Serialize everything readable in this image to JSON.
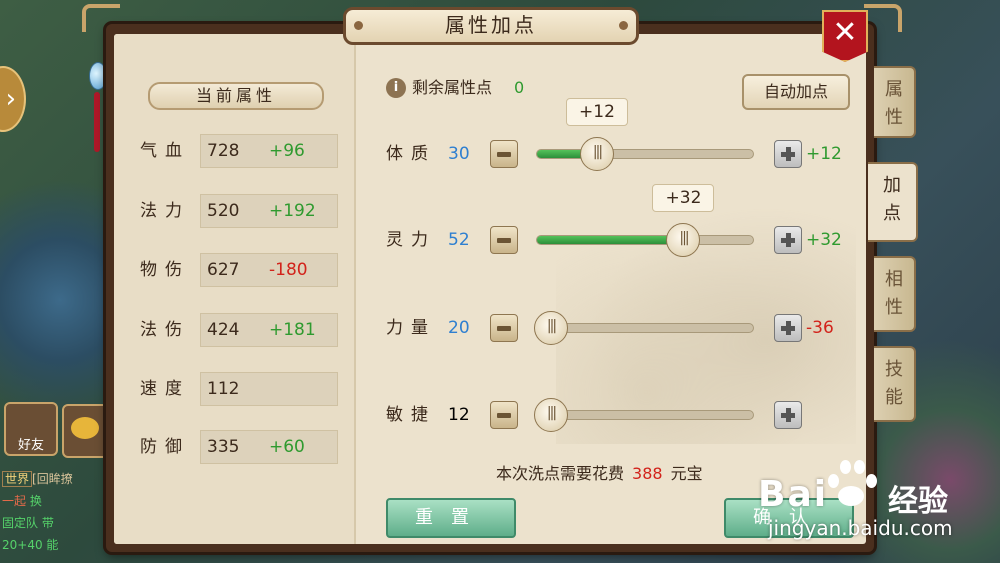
{
  "panel": {
    "title": "属性加点",
    "close_label": "✕"
  },
  "left": {
    "header": "当前属性",
    "stats": [
      {
        "label": "气血",
        "value": "728",
        "bonus": "+96",
        "bonus_kind": "pos"
      },
      {
        "label": "法力",
        "value": "520",
        "bonus": "+192",
        "bonus_kind": "pos"
      },
      {
        "label": "物伤",
        "value": "627",
        "bonus": "-180",
        "bonus_kind": "neg"
      },
      {
        "label": "法伤",
        "value": "424",
        "bonus": "+181",
        "bonus_kind": "pos"
      },
      {
        "label": "速度",
        "value": "112",
        "bonus": "",
        "bonus_kind": ""
      },
      {
        "label": "防御",
        "value": "335",
        "bonus": "+60",
        "bonus_kind": "pos"
      }
    ]
  },
  "right": {
    "info_icon": "i",
    "remaining_label": "剩余属性点",
    "remaining_value": "0",
    "auto_button": "自动加点",
    "attributes": [
      {
        "name": "体质",
        "value": "30",
        "value_color": "blue",
        "fraction": 0.25,
        "bubble": "+12",
        "delta": "+12",
        "delta_kind": "pos"
      },
      {
        "name": "灵力",
        "value": "52",
        "value_color": "blue",
        "fraction": 0.72,
        "bubble": "+32",
        "delta": "+32",
        "delta_kind": "pos"
      },
      {
        "name": "力量",
        "value": "20",
        "value_color": "blue",
        "fraction": 0.0,
        "bubble": "",
        "delta": "-36",
        "delta_kind": "neg"
      },
      {
        "name": "敏捷",
        "value": "12",
        "value_color": "plain",
        "fraction": 0.0,
        "bubble": "",
        "delta": "",
        "delta_kind": ""
      }
    ],
    "cost_prefix": "本次洗点需要花费",
    "cost_value": "388",
    "cost_unit": "元宝",
    "reset_button": "重置",
    "confirm_button": "确认"
  },
  "tabs": [
    {
      "label": "属性",
      "active": false
    },
    {
      "label": "加点",
      "active": true
    },
    {
      "label": "相性",
      "active": false
    },
    {
      "label": "技能",
      "active": false
    }
  ],
  "background": {
    "friend_label": "好友",
    "chat_lines": [
      {
        "channel": "世界",
        "text": "[回眸撩"
      },
      {
        "text": "一起",
        "extra": "换"
      },
      {
        "text": "固定队",
        "extra": "带"
      },
      {
        "text": "20+40",
        "extra": "能"
      }
    ]
  },
  "watermark": {
    "brand": "Bai",
    "brand2": "经验",
    "url": "jingyan.baidu.com"
  },
  "colors": {
    "accent_green": "#2f9a2f",
    "accent_red": "#d2231b",
    "accent_blue": "#2e7fd0"
  }
}
